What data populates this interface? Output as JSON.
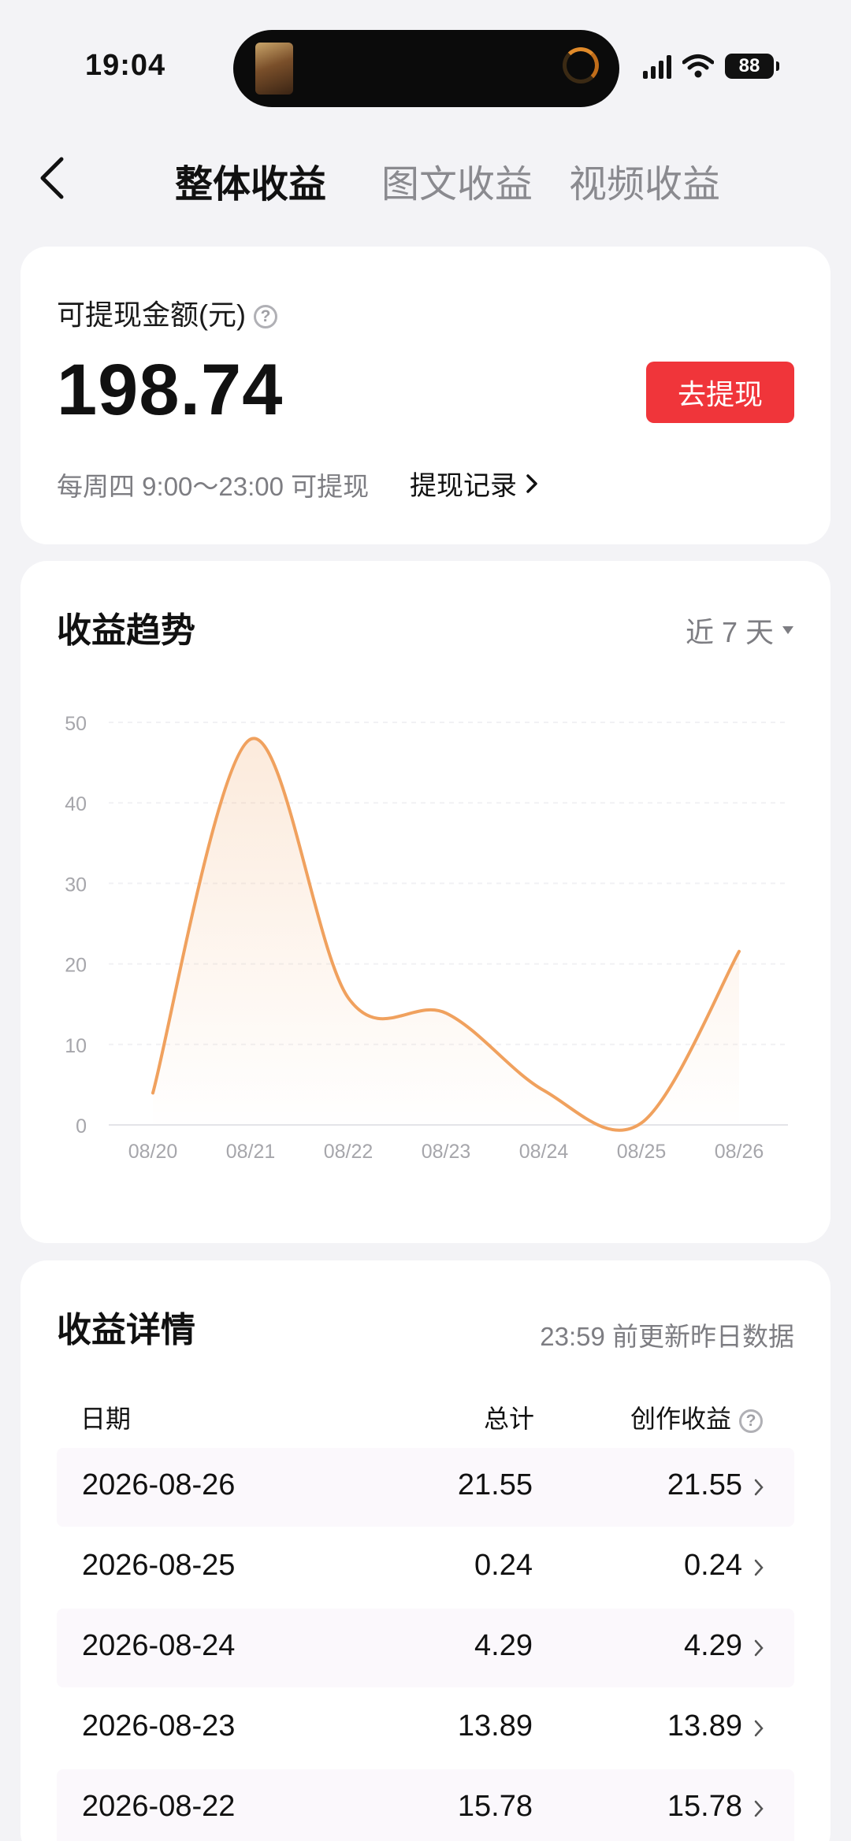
{
  "status_bar": {
    "time": "19:04",
    "battery": "88"
  },
  "nav": {
    "tabs": [
      "整体收益",
      "图文收益",
      "视频收益"
    ],
    "active_tab": 0
  },
  "balance": {
    "label": "可提现金额(元)",
    "amount": "198.74",
    "withdraw_button": "去提现",
    "schedule_note": "每周四 9:00～23:00 可提现",
    "record_link": "提现记录"
  },
  "trend": {
    "title": "收益趋势",
    "range_label": "近 7 天",
    "accent_color": "#f0a15e"
  },
  "chart_data": {
    "type": "line",
    "x": [
      "08/20",
      "08/21",
      "08/22",
      "08/23",
      "08/24",
      "08/25",
      "08/26"
    ],
    "values": [
      3.97,
      47.91,
      15.78,
      13.89,
      4.29,
      0.24,
      21.55
    ],
    "y_ticks": [
      0,
      10,
      20,
      30,
      40,
      50
    ],
    "ylim": [
      0,
      50
    ],
    "grid": true,
    "smooth": true,
    "area_fill": true,
    "color": "#f0a15e"
  },
  "detail": {
    "title": "收益详情",
    "update_note": "23:59 前更新昨日数据",
    "columns": [
      "日期",
      "总计",
      "创作收益"
    ],
    "rows": [
      {
        "date": "2026-08-26",
        "total": "21.55",
        "income": "21.55"
      },
      {
        "date": "2026-08-25",
        "total": "0.24",
        "income": "0.24"
      },
      {
        "date": "2026-08-24",
        "total": "4.29",
        "income": "4.29"
      },
      {
        "date": "2026-08-23",
        "total": "13.89",
        "income": "13.89"
      },
      {
        "date": "2026-08-22",
        "total": "15.78",
        "income": "15.78"
      }
    ]
  }
}
